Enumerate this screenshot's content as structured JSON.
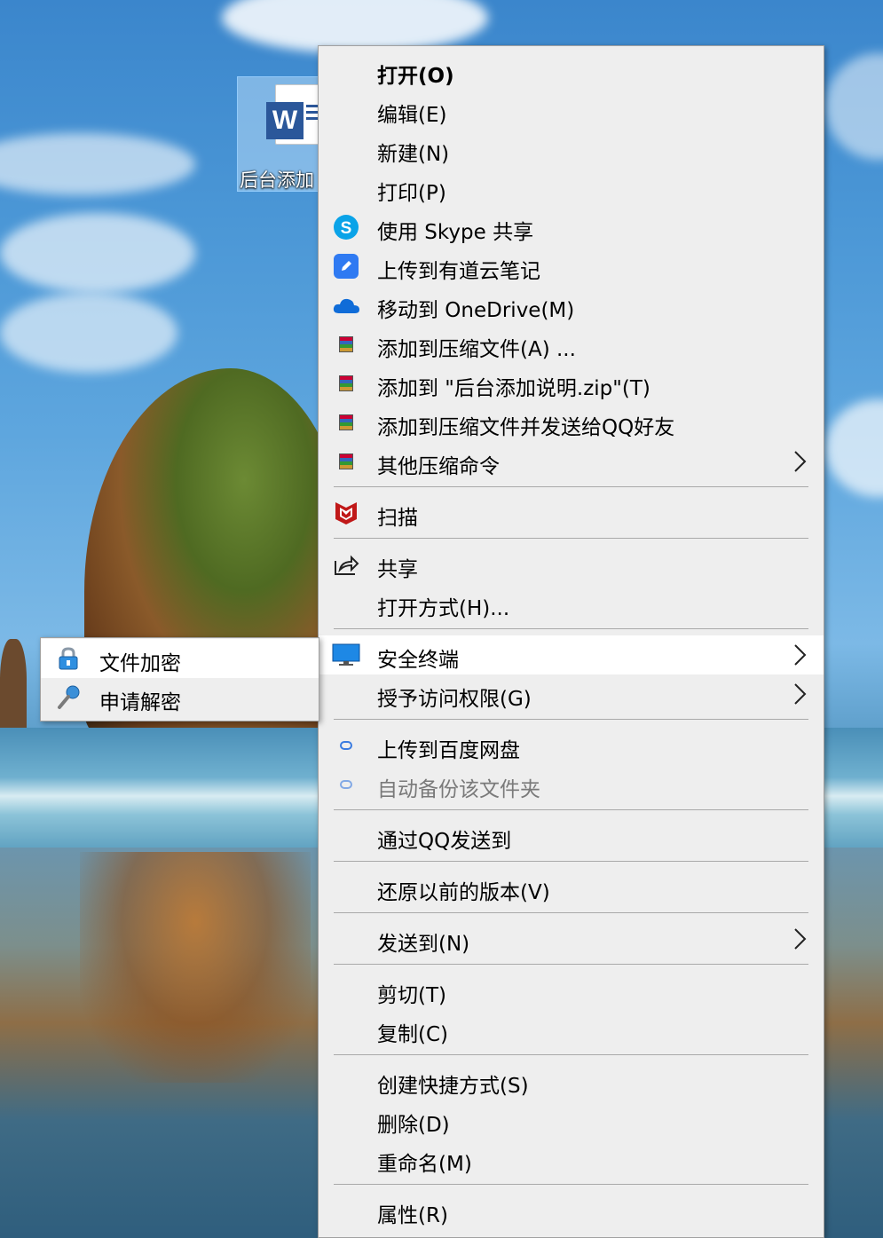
{
  "desktop": {
    "icon_label": "后台添加"
  },
  "context_menu": {
    "items": [
      {
        "label": "打开(O)",
        "icon": "",
        "bold": true
      },
      {
        "label": "编辑(E)",
        "icon": ""
      },
      {
        "label": "新建(N)",
        "icon": ""
      },
      {
        "label": "打印(P)",
        "icon": ""
      },
      {
        "label": "使用 Skype 共享",
        "icon": "skype-icon"
      },
      {
        "label": "上传到有道云笔记",
        "icon": "youdao-note-icon"
      },
      {
        "label": "移动到 OneDrive(M)",
        "icon": "onedrive-icon"
      },
      {
        "label": "添加到压缩文件(A) ...",
        "icon": "winrar-icon"
      },
      {
        "label": "添加到 \"后台添加说明.zip\"(T)",
        "icon": "winrar-icon"
      },
      {
        "label": "添加到压缩文件并发送给QQ好友",
        "icon": "winrar-icon"
      },
      {
        "label": "其他压缩命令",
        "icon": "winrar-icon",
        "submenu": true
      },
      {
        "label": "扫描",
        "icon": "mcafee-icon"
      },
      {
        "label": "共享",
        "icon": "share-icon"
      },
      {
        "label": "打开方式(H)...",
        "icon": ""
      },
      {
        "label": "安全终端",
        "icon": "monitor-icon",
        "submenu": true,
        "highlighted": true
      },
      {
        "label": "授予访问权限(G)",
        "icon": "",
        "submenu": true
      },
      {
        "label": "上传到百度网盘",
        "icon": "baidu-netdisk-icon"
      },
      {
        "label": "自动备份该文件夹",
        "icon": "baidu-netdisk-icon",
        "disabled": true
      },
      {
        "label": "通过QQ发送到",
        "icon": ""
      },
      {
        "label": "还原以前的版本(V)",
        "icon": ""
      },
      {
        "label": "发送到(N)",
        "icon": "",
        "submenu": true
      },
      {
        "label": "剪切(T)",
        "icon": ""
      },
      {
        "label": "复制(C)",
        "icon": ""
      },
      {
        "label": "创建快捷方式(S)",
        "icon": ""
      },
      {
        "label": "删除(D)",
        "icon": ""
      },
      {
        "label": "重命名(M)",
        "icon": ""
      },
      {
        "label": "属性(R)",
        "icon": ""
      }
    ]
  },
  "submenu": {
    "items": [
      {
        "label": "文件加密",
        "icon": "lock-icon",
        "highlighted": true
      },
      {
        "label": "申请解密",
        "icon": "key-icon"
      }
    ]
  },
  "colors": {
    "menu_bg": "#eeeeee",
    "highlight_bg": "#ffffff",
    "separator": "#a9a9a9",
    "word_blue": "#2b579a"
  }
}
